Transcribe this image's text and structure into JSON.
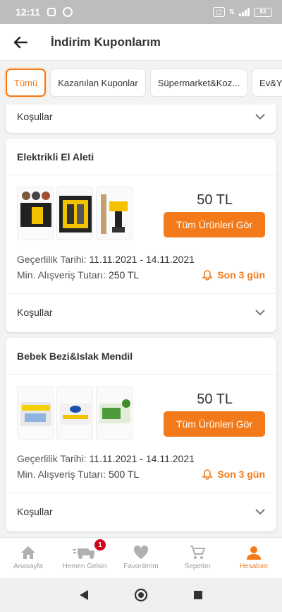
{
  "statusbar": {
    "time": "12:11",
    "battery": "83"
  },
  "header": {
    "title": "İndirim Kuponlarım"
  },
  "tabs": [
    {
      "label": "Tümü"
    },
    {
      "label": "Kazanılan Kuponlar"
    },
    {
      "label": "Süpermarket&Koz..."
    },
    {
      "label": "Ev&Yaşam"
    }
  ],
  "conditions_label": "Koşullar",
  "coupons": [
    {
      "title": "Elektrikli El Aleti",
      "amount": "50 TL",
      "button": "Tüm Ürünleri Gör",
      "validity_label": "Geçerlilik Tarihi:",
      "validity_value": "11.11.2021 - 14.11.2021",
      "min_label": "Min. Alışveriş Tutarı:",
      "min_value": "250 TL",
      "remaining": "Son 3 gün",
      "conditions": "Koşullar"
    },
    {
      "title": "Bebek Bezi&Islak Mendil",
      "amount": "50 TL",
      "button": "Tüm Ürünleri Gör",
      "validity_label": "Geçerlilik Tarihi:",
      "validity_value": "11.11.2021 - 14.11.2021",
      "min_label": "Min. Alışveriş Tutarı:",
      "min_value": "500 TL",
      "remaining": "Son 3 gün",
      "conditions": "Koşullar"
    }
  ],
  "bottom_nav": [
    {
      "label": "Anasayfa",
      "icon": "home-icon"
    },
    {
      "label": "Hemen Gelsin",
      "icon": "delivery-icon",
      "badge": "1"
    },
    {
      "label": "Favorilerim",
      "icon": "heart-icon"
    },
    {
      "label": "Sepetim",
      "icon": "cart-icon"
    },
    {
      "label": "Hesabım",
      "icon": "user-icon"
    }
  ],
  "colors": {
    "accent": "#f27a1a",
    "badge": "#d0021b"
  }
}
